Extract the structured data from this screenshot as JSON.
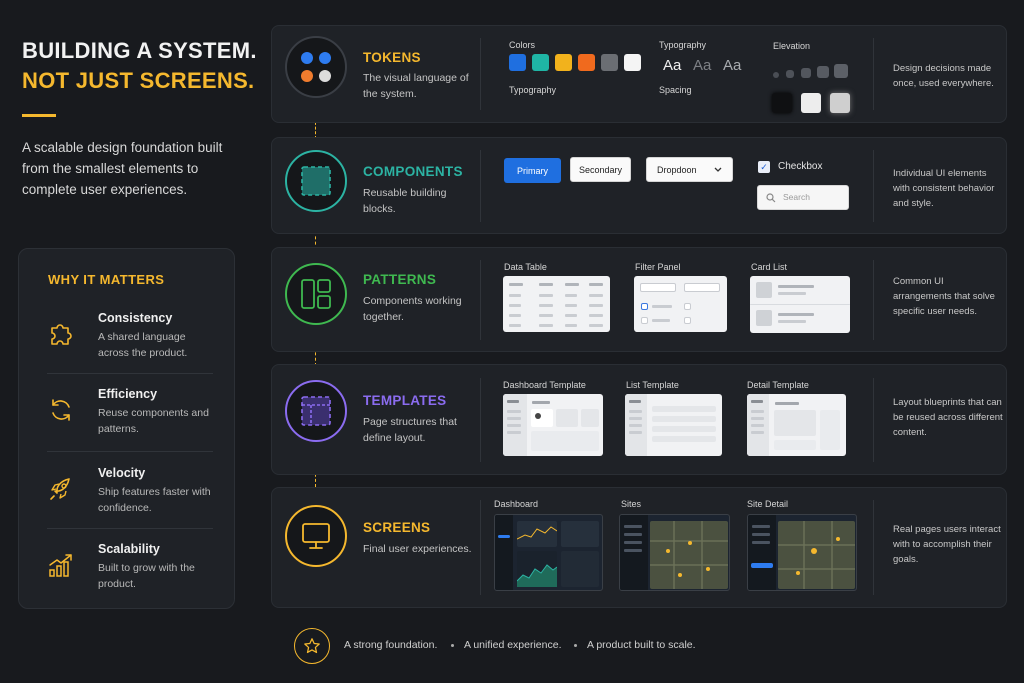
{
  "hero": {
    "title_line1": "BUILDING A SYSTEM.",
    "title_line2": "NOT JUST SCREENS.",
    "description": "A scalable design foundation built from the smallest elements to complete user experiences."
  },
  "why_it_matters": {
    "title": "WHY IT MATTERS",
    "items": [
      {
        "name": "Consistency",
        "desc": "A shared language across the product.",
        "icon": "puzzle-icon"
      },
      {
        "name": "Efficiency",
        "desc": "Reuse components and patterns.",
        "icon": "refresh-icon"
      },
      {
        "name": "Velocity",
        "desc": "Ship features faster with confidence.",
        "icon": "rocket-icon"
      },
      {
        "name": "Scalability",
        "desc": "Built to grow with the product.",
        "icon": "growth-chart-icon"
      }
    ]
  },
  "stages": [
    {
      "name": "TOKENS",
      "desc": "The visual language of the system.",
      "note": "Design decisions made once, used everywhere.",
      "color": "#f5b82e"
    },
    {
      "name": "COMPONENTS",
      "desc": "Reusable building blocks.",
      "note": "Individual UI elements with consistent behavior and style.",
      "color": "#2cb3a3"
    },
    {
      "name": "PATTERNS",
      "desc": "Components working together.",
      "note": "Common UI arrangements that solve specific user needs.",
      "color": "#3fb950"
    },
    {
      "name": "TEMPLATES",
      "desc": "Page structures that define layout.",
      "note": "Layout blueprints that can be reused across different content.",
      "color": "#8b6cf0"
    },
    {
      "name": "SCREENS",
      "desc": "Final user experiences.",
      "note": "Real pages users interact with to accomplish their goals.",
      "color": "#f5b82e"
    }
  ],
  "tokens": {
    "colors_label": "Colors",
    "typography_label": "Typography",
    "typography_label_2": "Typography",
    "spacing_label": "Spacing",
    "elevation_label": "Elevation",
    "typography_sample": "Aa",
    "swatches": [
      "#1f6fe0",
      "#1fb5a5",
      "#f2b21c",
      "#f06a1e",
      "#6b6e73",
      "#f4f4f4"
    ],
    "dot_colors": [
      "#2e7cf0",
      "#2e7cf0",
      "#f07c2e",
      "#dcdcdc"
    ]
  },
  "components": {
    "primary_label": "Primary",
    "secondary_label": "Secondary",
    "dropdown_label": "Dropdoon",
    "checkbox_label": "Checkbox",
    "search_placeholder": "Search"
  },
  "patterns": {
    "data_table_label": "Data Table",
    "filter_panel_label": "Filter Panel",
    "card_list_label": "Card List"
  },
  "templates": {
    "dashboard_label": "Dashboard Template",
    "list_label": "List Template",
    "detail_label": "Detail Template"
  },
  "screens": {
    "dashboard_label": "Dashboard",
    "sites_label": "Sites",
    "site_detail_label": "Site Detail"
  },
  "footer": {
    "item1": "A strong foundation.",
    "item2": "A unified experience.",
    "item3": "A product built to scale."
  }
}
